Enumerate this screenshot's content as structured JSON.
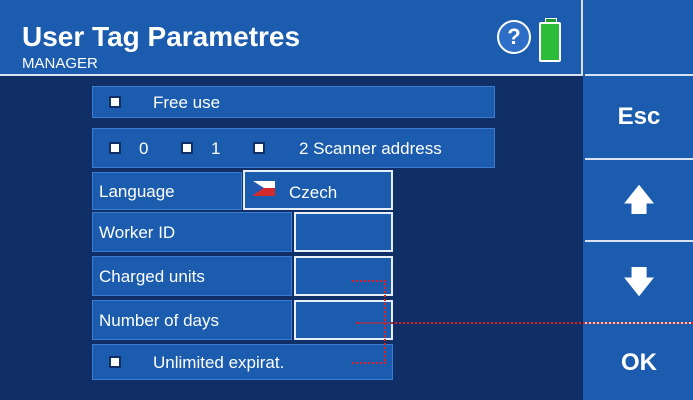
{
  "header": {
    "title": "User Tag Parametres",
    "subtitle": "MANAGER",
    "help_label": "?"
  },
  "sidebar": {
    "esc_label": "Esc",
    "up_label": "🡅",
    "down_label": "🡇",
    "ok_label": "OK"
  },
  "form": {
    "free_use_label": "Free use",
    "scanner": {
      "opt0": "0",
      "opt1": "1",
      "opt2": "2 Scanner address"
    },
    "language_label": "Language",
    "language_value": "Czech",
    "worker_id_label": "Worker ID",
    "charged_units_label": "Charged units",
    "number_of_days_label": "Number of days",
    "unlimited_label": "Unlimited expirat."
  },
  "colors": {
    "background": "#0f2f66",
    "panel": "#1b5cae",
    "callout": "#e02020",
    "battery": "#2dbb3a"
  },
  "icons": [
    "help-icon",
    "battery-icon",
    "czech-flag-icon",
    "arrow-up-icon",
    "arrow-down-icon"
  ]
}
